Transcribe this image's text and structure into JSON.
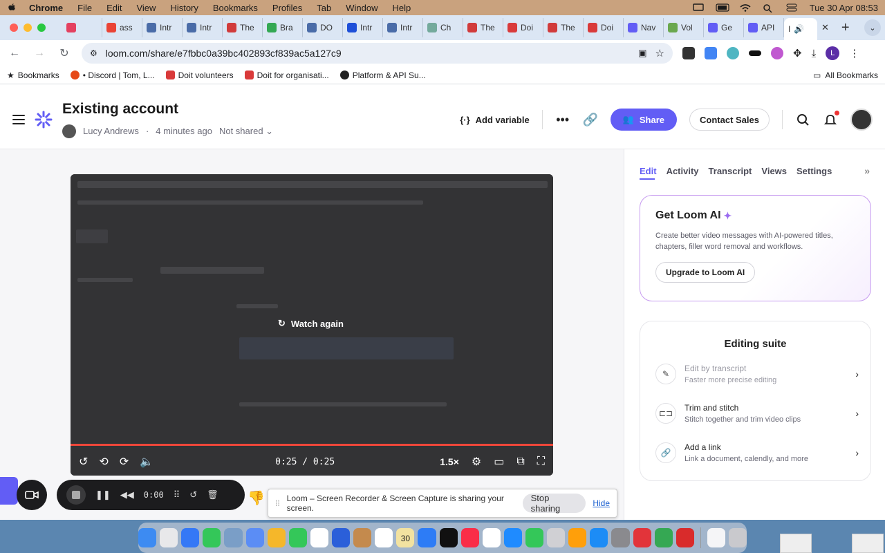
{
  "menubar": {
    "app_name": "Chrome",
    "items": [
      "File",
      "Edit",
      "View",
      "History",
      "Bookmarks",
      "Profiles",
      "Tab",
      "Window",
      "Help"
    ],
    "clock": "Tue 30 Apr  08:53"
  },
  "tabs": [
    {
      "label": "",
      "color": "#e4405f"
    },
    {
      "label": "ass",
      "color": "#ea4335"
    },
    {
      "label": "Intr",
      "color": "#4a6ca8"
    },
    {
      "label": "Intr",
      "color": "#4a6ca8"
    },
    {
      "label": "The",
      "color": "#d13b3b"
    },
    {
      "label": "Bra",
      "color": "#34a853"
    },
    {
      "label": "DO",
      "color": "#4a6ca8"
    },
    {
      "label": "Intr",
      "color": "#1e4fd8"
    },
    {
      "label": "Intr",
      "color": "#4a6ca8"
    },
    {
      "label": "Ch",
      "color": "#74aa9c"
    },
    {
      "label": "The",
      "color": "#d13b3b"
    },
    {
      "label": "Doi",
      "color": "#d93a3a"
    },
    {
      "label": "The",
      "color": "#d13b3b"
    },
    {
      "label": "Doi",
      "color": "#d93a3a"
    },
    {
      "label": "Nav",
      "color": "#625df5"
    },
    {
      "label": "Vol",
      "color": "#6aa84f"
    },
    {
      "label": "Ge",
      "color": "#625df5"
    },
    {
      "label": "API",
      "color": "#625df5"
    }
  ],
  "active_tab": {
    "label": "I"
  },
  "address_bar": {
    "url": "loom.com/share/e7fbbc0a39bc402893cf839ac5a127c9"
  },
  "profile_initial": "L",
  "bookmarks": {
    "label": "Bookmarks",
    "items": [
      "• Discord | Tom, L...",
      "Doit volunteers",
      "Doit for organisati...",
      "Platform & API Su..."
    ],
    "all": "All Bookmarks"
  },
  "header": {
    "title": "Existing account",
    "author": "Lucy Andrews",
    "time_ago": "4 minutes ago",
    "sharing": "Not shared",
    "add_variable": "Add variable",
    "share": "Share",
    "contact_sales": "Contact Sales"
  },
  "player": {
    "watch_again": "Watch again",
    "time": "0:25 / 0:25",
    "speed": "1.5×",
    "progress_fraction": 1.0
  },
  "panel": {
    "tabs": [
      "Edit",
      "Activity",
      "Transcript",
      "Views",
      "Settings"
    ],
    "active_tab": "Edit",
    "ai_card": {
      "title": "Get Loom AI",
      "description": "Create better video messages with AI-powered titles, chapters, filler word removal and workflows.",
      "button": "Upgrade to Loom AI"
    },
    "editing_suite": {
      "title": "Editing suite",
      "items": [
        {
          "name": "Edit by transcript",
          "sub": "Faster more precise editing",
          "icon": "wand-icon",
          "disabled": true
        },
        {
          "name": "Trim and stitch",
          "sub": "Stitch together and trim video clips",
          "icon": "trim-icon",
          "disabled": false
        },
        {
          "name": "Add a link",
          "sub": "Link a document, calendly, and more",
          "icon": "link-icon",
          "disabled": false
        }
      ]
    }
  },
  "recorder": {
    "time": "0:00"
  },
  "sharebar": {
    "message": "Loom – Screen Recorder & Screen Capture is sharing your screen.",
    "stop": "Stop sharing",
    "hide": "Hide"
  },
  "dock": {
    "calendar_day": "30"
  },
  "colors": {
    "brand": "#625df5",
    "progress": "#f0473a",
    "menubar": "#c9a27e"
  }
}
